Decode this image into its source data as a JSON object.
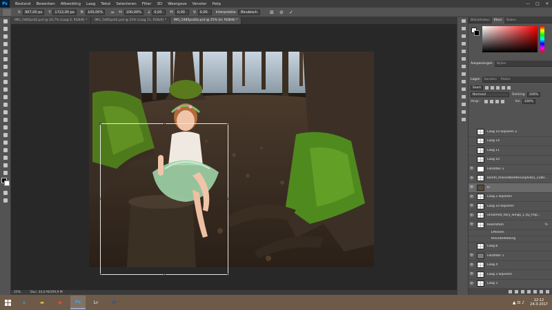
{
  "app": {
    "logo": "Ps"
  },
  "menu": [
    "Bestand",
    "Bewerken",
    "Afbeelding",
    "Laag",
    "Tekst",
    "Selecteren",
    "Filter",
    "3D",
    "Weergave",
    "Venster",
    "Help"
  ],
  "window_controls": {
    "minimize": "—",
    "maximize": "□",
    "close": "✕"
  },
  "options_bar": {
    "x_label": "X:",
    "x_value": "907,00 px",
    "y_label": "Y:",
    "y_value": "1722,00 px",
    "w_label": "B:",
    "w_value": "100,00%",
    "h_label": "H:",
    "h_value": "100,00%",
    "angle_value": "0,00",
    "hskew_label": "H:",
    "hskew_value": "0,00",
    "vskew_label": "V:",
    "vskew_value": "0,00",
    "interp_label": "Interpolatie:",
    "interp_value": "Bicubisch",
    "cancel_symbol": "⊘",
    "commit_symbol": "✓"
  },
  "doc_tabs": [
    {
      "label": "IMG_5485psd2.psd @ 16,7% (Laag 0, RGB/8) *",
      "active": false
    },
    {
      "label": "IMG_5485psd2.psd @ 25% (Laag 11, RGB/8) *",
      "active": false
    },
    {
      "label": "IMG_5485psd2a.psd @ 25% (kl, RGB/8) *",
      "active": true
    }
  ],
  "status": {
    "zoom": "25%",
    "doc": "Doc: 34,0 M/209,9 M"
  },
  "color_panel": {
    "tabs": [
      "Bibliotheken",
      "Kleur",
      "Stalen"
    ],
    "active": "Kleur"
  },
  "adjust_panel": {
    "tabs": [
      "Aanpassingen",
      "Stijlen"
    ]
  },
  "layers_panel": {
    "tabs": [
      "Lagen",
      "Kanalen",
      "Paden"
    ],
    "filter_kind": "Soort",
    "blend_mode": "Normaal",
    "opacity_label": "Dekking:",
    "opacity_value": "100%",
    "lock_label": "Vergr.:",
    "fill_label": "Vul:",
    "fill_value": "100%",
    "layers": [
      {
        "name": "Laag 10 kopiëren 2",
        "thumb": "trans",
        "eye": "",
        "fx": ""
      },
      {
        "name": "Laag 14",
        "thumb": "trans",
        "eye": "",
        "fx": ""
      },
      {
        "name": "Laag 11",
        "thumb": "trans",
        "eye": "",
        "fx": ""
      },
      {
        "name": "Laag 10",
        "thumb": "trans",
        "eye": "",
        "fx": ""
      },
      {
        "name": "Fotofilter 2",
        "thumb": "white",
        "eye": "👁",
        "fx": ""
      },
      {
        "name": "kerkhl_mossellbeetle1e(photo)_1280...",
        "thumb": "trans",
        "eye": "👁",
        "fx": ""
      },
      {
        "name": "kl",
        "thumb": "photo",
        "eye": "👁",
        "fx": "",
        "selected": true
      },
      {
        "name": "Laag 2 kopiëren",
        "thumb": "trans",
        "eye": "👁",
        "fx": ""
      },
      {
        "name": "Laag 10 kopiëren",
        "thumb": "trans",
        "eye": "👁",
        "fx": ""
      },
      {
        "name": "unnamed_fairy_wings_1_by_frop...",
        "thumb": "trans",
        "eye": "👁",
        "fx": ""
      },
      {
        "name": "boomstam",
        "thumb": "trans",
        "eye": "👁",
        "fx": "fx"
      },
      {
        "name": "Effecten",
        "thumb": "none",
        "eye": "",
        "fx": "",
        "sub": true
      },
      {
        "name": "Kleurbedekking",
        "thumb": "none",
        "eye": "",
        "fx": "",
        "sub": true
      },
      {
        "name": "Laag 8",
        "thumb": "trans",
        "eye": "",
        "fx": ""
      },
      {
        "name": "Fotofilter 1",
        "thumb": "gray",
        "eye": "👁",
        "fx": ""
      },
      {
        "name": "Laag 4",
        "thumb": "trans",
        "eye": "👁",
        "fx": ""
      },
      {
        "name": "Laag 3 kopiëren",
        "thumb": "trans",
        "eye": "👁",
        "fx": ""
      },
      {
        "name": "Laag 3",
        "thumb": "trans",
        "eye": "👁",
        "fx": ""
      },
      {
        "name": "Belichting 1",
        "thumb": "white",
        "eye": "👁",
        "fx": ""
      },
      {
        "name": "Laag 2",
        "thumb": "trans",
        "eye": "👁",
        "fx": ""
      }
    ]
  },
  "taskbar": {
    "apps": [
      {
        "name": "internet-explorer",
        "label": "e",
        "color": "#1ea0e6",
        "active": false
      },
      {
        "name": "file-explorer",
        "label": "▬",
        "color": "#f5c542",
        "active": false
      },
      {
        "name": "chrome",
        "label": "●",
        "color": "#e8453c",
        "active": false
      },
      {
        "name": "photoshop",
        "label": "Ps",
        "color": "#31a8ff",
        "active": true
      },
      {
        "name": "lightroom",
        "label": "Lr",
        "color": "#a6c8e0",
        "active": false
      },
      {
        "name": "word",
        "label": "W",
        "color": "#2b5797",
        "active": false
      }
    ],
    "tray_symbols": "▲ ⊡ ♪",
    "time": "22:12",
    "date": "24-3-2017"
  }
}
